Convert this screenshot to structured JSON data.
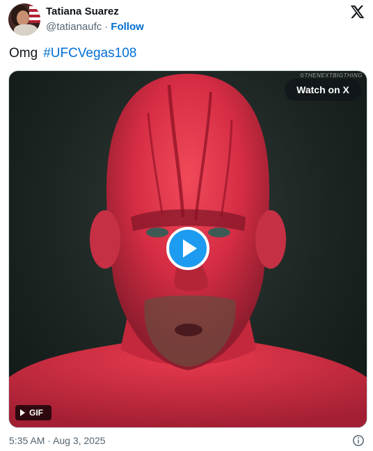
{
  "author": {
    "display_name": "Tatiana Suarez",
    "handle": "@tatianaufc",
    "separator": "·",
    "follow_label": "Follow"
  },
  "tweet": {
    "text": "Omg",
    "hashtag": "#UFCVegas108"
  },
  "media": {
    "watermark": "©THENEXTBIGTHING",
    "watch_label": "Watch on X",
    "gif_label": "GIF",
    "play_icon": "play-icon"
  },
  "footer": {
    "timestamp": "5:35 AM · Aug 3, 2025",
    "info_icon": "info-icon"
  },
  "colors": {
    "link": "#006fd6",
    "play_button": "#1d9bf0",
    "secondary_text": "#536471"
  }
}
